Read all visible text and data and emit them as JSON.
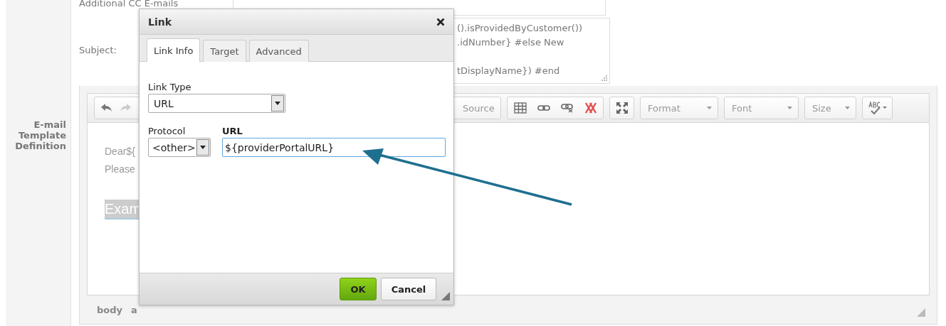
{
  "form": {
    "section_label": "E-mail Template Definition",
    "cc_label": "Additional CC E-mails",
    "subject_label": "Subject:",
    "subject_lines": [
      {
        "text": "().isProvidedByCustomer())",
        "blank_before": false
      },
      {
        "text": ".idNumber} #else New",
        "blank_before": false
      },
      {
        "text": "tDisplayName}) #end",
        "blank_before": true
      }
    ]
  },
  "editor": {
    "history": [
      {
        "kind": "undo",
        "disabled": false
      },
      {
        "kind": "redo",
        "disabled": true
      }
    ],
    "source_button": "Source",
    "dropdowns": [
      "Format",
      "Font",
      "Size"
    ],
    "lines": [
      {
        "text": "Dear${",
        "selected": false
      },
      {
        "text": "Please",
        "selected": false
      },
      {
        "text": "Exam",
        "selected": true
      }
    ],
    "path": [
      "body",
      "a"
    ]
  },
  "dialog": {
    "title": "Link",
    "tabs": [
      {
        "label": "Link Info",
        "selected": true
      },
      {
        "label": "Target",
        "selected": false
      },
      {
        "label": "Advanced",
        "selected": false
      }
    ],
    "link_type_label": "Link Type",
    "link_type_value": "URL",
    "protocol_label": "Protocol",
    "protocol_value": "<other>",
    "url_label": "URL",
    "url_value": "${providerPortalURL}",
    "buttons": [
      {
        "label": "OK",
        "kind": "primary"
      },
      {
        "label": "Cancel",
        "kind": "secondary"
      }
    ]
  }
}
